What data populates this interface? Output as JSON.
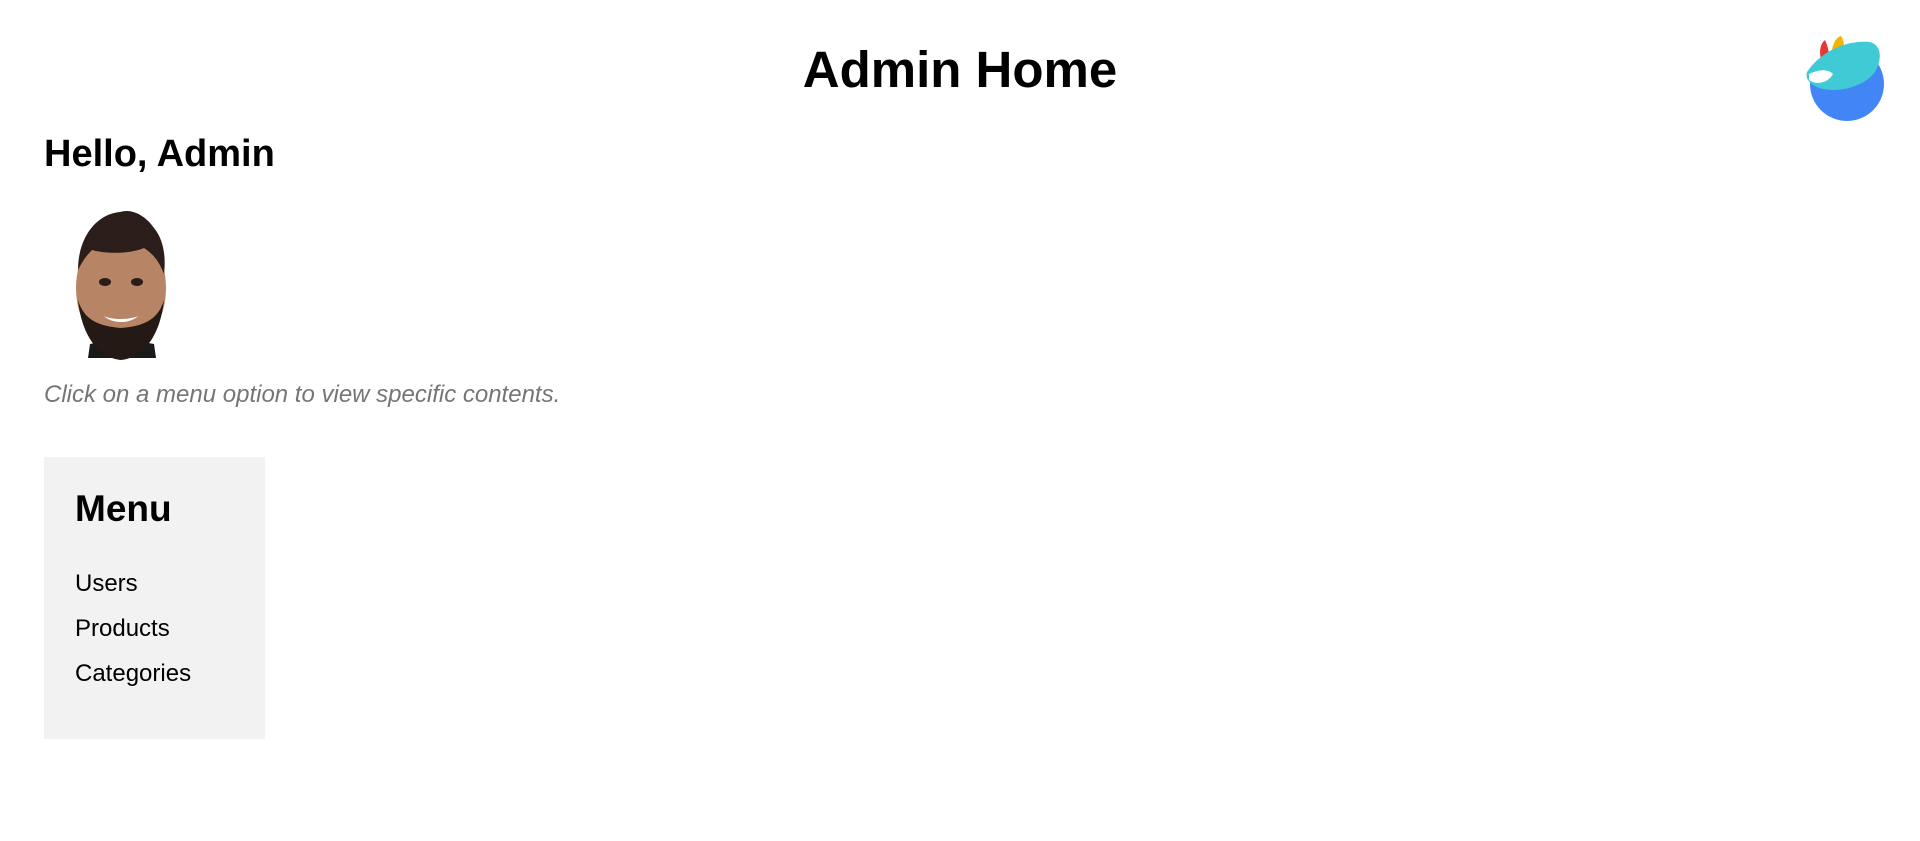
{
  "header": {
    "title": "Admin Home",
    "logo_icon": "peacock-feather-logo-icon",
    "logo_colors": [
      "#e53935",
      "#f5b400",
      "#3fcad6",
      "#4285f4"
    ]
  },
  "welcome": {
    "greeting": "Hello, Admin",
    "avatar_icon": "admin-avatar-photo",
    "hint": "Click on a menu option to view specific contents."
  },
  "menu": {
    "heading": "Menu",
    "background": "#f2f2f2",
    "items": [
      {
        "label": "Users"
      },
      {
        "label": "Products"
      },
      {
        "label": "Categories"
      }
    ]
  }
}
